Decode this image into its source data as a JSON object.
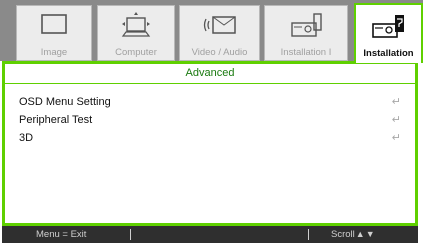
{
  "tabs": [
    {
      "label": "Image",
      "icon": "monitor-icon"
    },
    {
      "label": "Computer",
      "icon": "computer-icon"
    },
    {
      "label": "Video / Audio",
      "icon": "video-audio-icon"
    },
    {
      "label": "Installation I",
      "icon": "installation-i-icon"
    },
    {
      "label": "Installation",
      "icon": "installation-ii-icon"
    }
  ],
  "section_title": "Advanced",
  "menu_items": [
    {
      "label": "OSD Menu Setting",
      "enter": "↵"
    },
    {
      "label": "Peripheral Test",
      "enter": "↵"
    },
    {
      "label": "3D",
      "enter": "↵"
    }
  ],
  "footer": {
    "left": "Menu = Exit",
    "right": "Scroll",
    "up_arrow": "▲",
    "down_arrow": "▼"
  },
  "colors": {
    "accent": "#5fd000",
    "tab_strip": "#8a8a8a",
    "footer_bg": "#2f2f2f"
  }
}
